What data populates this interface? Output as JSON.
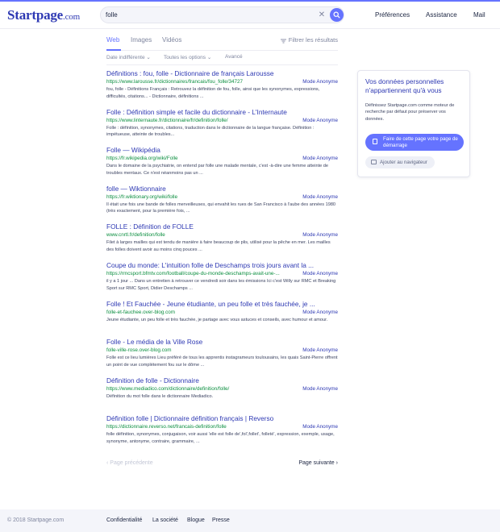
{
  "brand": {
    "logo_main": "Startpage",
    "logo_dom": ".com"
  },
  "search": {
    "query": "folle"
  },
  "header_nav": {
    "preferences": "Préférences",
    "support": "Assistance",
    "mail": "Mail"
  },
  "tabs": {
    "web": "Web",
    "images": "Images",
    "videos": "Vidéos",
    "filter": "Filtrer les résultats"
  },
  "subfilters": {
    "date": "Date indifférente",
    "options": "Toutes les options",
    "advanced": "Avancé"
  },
  "results": [
    {
      "title": "Définitions : fou, folle - Dictionnaire de français Larousse",
      "url": "https://www.larousse.fr/dictionnaires/francais/fou_folle/34727",
      "anon": "Mode Anonyme",
      "desc": "fou, folle - Définitions Français : Retrouvez la définition de fou, folle, ainsi que les synonymes, expressions, difficultés, citations... - Dictionnaire, définitions ..."
    },
    {
      "title": "Folle : Définition simple et facile du dictionnaire - L'Internaute",
      "url": "https://www.linternaute.fr/dictionnaire/fr/definition/folle/",
      "anon": "Mode Anonyme",
      "desc": "Folle : définition, synonymes, citations, traduction dans le dictionnaire de la langue française. Définition : impétueuse, atteinte de troubles..."
    },
    {
      "title": "Folle — Wikipédia",
      "url": "https://fr.wikipedia.org/wiki/Folle",
      "anon": "Mode Anonyme",
      "desc": "Dans le domaine de la psychiatrie, on entend par folle une malade mentale, c'est -à-dire une femme atteinte de troubles mentaux. Ce n'est néanmoins pas un ..."
    },
    {
      "title": "folle — Wiktionnaire",
      "url": "https://fr.wiktionary.org/wiki/folle",
      "anon": "Mode Anonyme",
      "desc": "Il était une fois une bande de folles merveilleuses, qui envahit les rues de San Francisco à l'aube des années 1980 (très exactement, pour la première fois, ..."
    },
    {
      "title": "FOLLE : Définition de FOLLE",
      "url": "www.cnrtl.fr/definition/folle",
      "anon": "Mode Anonyme",
      "desc": "Filet à larges mailles qui est tendu de manière à faire beaucoup de plis, utilisé pour la pêche en mer. Les mailles des folles doivent avoir au moins cinq pouces ..."
    },
    {
      "title": "Coupe du monde: L'intuition folle de Deschamps trois jours avant la ...",
      "url": "https://rmcsport.bfmtv.com/football/coupe-du-monde-deschamps-avait-une-...",
      "anon": "Mode Anonyme",
      "desc": "il y a 1 jour ... Dans un entretien à retrouver ce vendredi soir dans les émissions Ici c'est Willy sur RMC et Breaking Sport sur RMC Sport, Didier Deschamps ..."
    },
    {
      "title": "Folle ! Et Fauchée - Jeune étudiante, un peu folle et très fauchée, je ...",
      "url": "folle-et-fauchee.over-blog.com",
      "anon": "Mode Anonyme",
      "desc": "Jeune étudiante, un peu folle et très fauchée, je partage avec vous astuces et conseils, avec humour et amour."
    },
    {
      "title": "Folle - Le média de la Ville Rose",
      "url": "folle-ville-rose.over-blog.com",
      "anon": "Mode Anonyme",
      "desc": "Folle est ce lieu lumières Lieu préféré de tous les apprentis instagrameurs toulousains, les quais Saint-Pierre offrent un point de vue complètement fou sur le dôme ..."
    },
    {
      "title": "Définition de folle - Dictionnaire",
      "url": "https://www.mediadico.com/dictionnaire/definition/folle/",
      "anon": "Mode Anonyme",
      "desc": "Définition du mot folle dans le dictionnaire Mediadico."
    },
    {
      "title": "Définition folle | Dictionnaire définition français | Reverso",
      "url": "https://dictionnaire.reverso.net/francais-definition/folle",
      "anon": "Mode Anonyme",
      "desc": "folle définition, synonymes, conjugaison, voir aussi 'elle est folle de',fol',follet', folleté', expression, exemple, usage, synonyme, antonyme, contraire, grammaire, ..."
    }
  ],
  "pager": {
    "prev": "Page précédente",
    "next": "Page suivante"
  },
  "privacy_card": {
    "title": "Vos données personnelles n'appartiennent qu'à vous",
    "text": "Définissez Startpage.com comme moteur de recherche par défaut pour préserver vos données.",
    "btn_home": "Faire de cette page votre page de démarrage",
    "btn_add": "Ajouter au navigateur"
  },
  "footer": {
    "copyright": "© 2018 Startpage.com",
    "privacy": "Confidentialité",
    "company": "La société",
    "blog": "Blogue",
    "press": "Presse"
  },
  "colors": {
    "accent": "#6573ff",
    "title_blue": "#2e39b3",
    "url_green": "#0b8e3f"
  }
}
